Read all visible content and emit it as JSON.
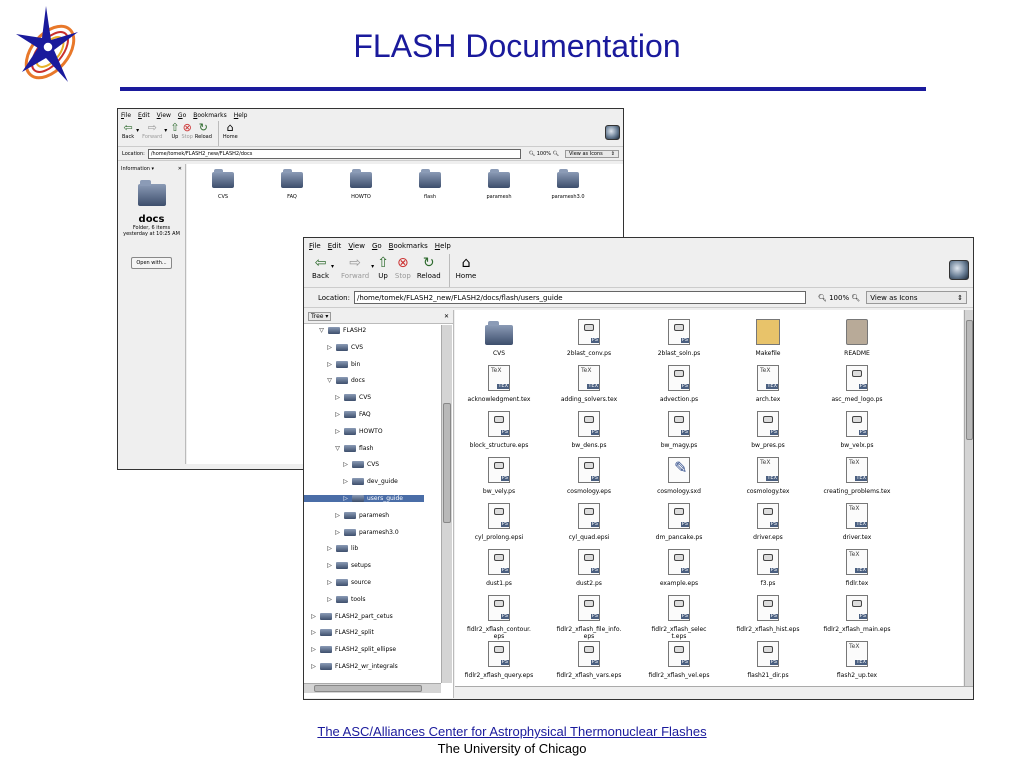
{
  "slide": {
    "title": "FLASH Documentation",
    "footer_line1": "The ASC/Alliances Center for Astrophysical Thermonuclear Flashes",
    "footer_line2": "The University of Chicago"
  },
  "colors": {
    "slide_blue": "#1a1a9c",
    "folder_blue": "#3d4e6c"
  },
  "menu": [
    "File",
    "Edit",
    "View",
    "Go",
    "Bookmarks",
    "Help"
  ],
  "toolbar": {
    "back": "Back",
    "forward": "Forward",
    "up": "Up",
    "stop": "Stop",
    "reload": "Reload",
    "home": "Home"
  },
  "back_window": {
    "location_label": "Location:",
    "location": "/home/tomek/FLASH2_new/FLASH2/docs",
    "zoom": "100%",
    "view_as": "View as Icons",
    "panel_title": "Information",
    "folder_name": "docs",
    "folder_info": "Folder, 6 items",
    "folder_date": "yesterday at 10:25 AM",
    "open_with": "Open with...",
    "items": [
      "CVS",
      "FAQ",
      "HOWTO",
      "flash",
      "paramesh",
      "paramesh3.0"
    ]
  },
  "front_window": {
    "location_label": "Location:",
    "location": "/home/tomek/FLASH2_new/FLASH2/docs/flash/users_guide",
    "zoom": "100%",
    "view_as": "View as Icons",
    "tree_label": "Tree",
    "tree": [
      {
        "label": "FLASH2",
        "indent": 1,
        "open": true
      },
      {
        "label": "CVS",
        "indent": 2
      },
      {
        "label": "bin",
        "indent": 2
      },
      {
        "label": "docs",
        "indent": 2,
        "open": true
      },
      {
        "label": "CVS",
        "indent": 3
      },
      {
        "label": "FAQ",
        "indent": 3
      },
      {
        "label": "HOWTO",
        "indent": 3
      },
      {
        "label": "flash",
        "indent": 3,
        "open": true
      },
      {
        "label": "CVS",
        "indent": 4
      },
      {
        "label": "dev_guide",
        "indent": 4
      },
      {
        "label": "users_guide",
        "indent": 4,
        "selected": true
      },
      {
        "label": "paramesh",
        "indent": 3
      },
      {
        "label": "paramesh3.0",
        "indent": 3
      },
      {
        "label": "lib",
        "indent": 2
      },
      {
        "label": "setups",
        "indent": 2
      },
      {
        "label": "source",
        "indent": 2
      },
      {
        "label": "tools",
        "indent": 2
      },
      {
        "label": "FLASH2_part_cetus",
        "indent": 0
      },
      {
        "label": "FLASH2_split",
        "indent": 0
      },
      {
        "label": "FLASH2_split_ellipse",
        "indent": 0
      },
      {
        "label": "FLASH2_wr_integrals",
        "indent": 0
      }
    ],
    "files": [
      {
        "name": "CVS",
        "kind": "folder"
      },
      {
        "name": "2blast_conv.ps",
        "kind": "ps"
      },
      {
        "name": "2blast_soln.ps",
        "kind": "ps"
      },
      {
        "name": "Makefile",
        "kind": "make"
      },
      {
        "name": "README",
        "kind": "plain"
      },
      {
        "name": "acknowledgment.tex",
        "kind": "tex"
      },
      {
        "name": "adding_solvers.tex",
        "kind": "tex"
      },
      {
        "name": "advection.ps",
        "kind": "ps"
      },
      {
        "name": "arch.tex",
        "kind": "tex"
      },
      {
        "name": "asc_med_logo.ps",
        "kind": "ps"
      },
      {
        "name": "block_structure.eps",
        "kind": "ps"
      },
      {
        "name": "bw_dens.ps",
        "kind": "ps"
      },
      {
        "name": "bw_magy.ps",
        "kind": "ps"
      },
      {
        "name": "bw_pres.ps",
        "kind": "ps"
      },
      {
        "name": "bw_velx.ps",
        "kind": "ps"
      },
      {
        "name": "bw_vely.ps",
        "kind": "ps"
      },
      {
        "name": "cosmology.eps",
        "kind": "ps"
      },
      {
        "name": "cosmology.sxd",
        "kind": "sxd"
      },
      {
        "name": "cosmology.tex",
        "kind": "tex"
      },
      {
        "name": "creating_problems.tex",
        "kind": "tex"
      },
      {
        "name": "cyl_prolong.epsi",
        "kind": "ps"
      },
      {
        "name": "cyl_quad.epsi",
        "kind": "ps"
      },
      {
        "name": "dm_pancake.ps",
        "kind": "ps"
      },
      {
        "name": "driver.eps",
        "kind": "ps"
      },
      {
        "name": "driver.tex",
        "kind": "tex"
      },
      {
        "name": "dust1.ps",
        "kind": "ps"
      },
      {
        "name": "dust2.ps",
        "kind": "ps"
      },
      {
        "name": "example.eps",
        "kind": "ps"
      },
      {
        "name": "f3.ps",
        "kind": "ps"
      },
      {
        "name": "fidlr.tex",
        "kind": "tex"
      },
      {
        "name": "fidlr2_xflash_contour.eps",
        "kind": "ps",
        "l1": "fidlr2_xflash_contour.",
        "l2": "eps"
      },
      {
        "name": "fidlr2_xflash_file_info.eps",
        "kind": "ps",
        "l1": "fidlr2_xflash_file_info.",
        "l2": "eps"
      },
      {
        "name": "fidlr2_xflash_select.eps",
        "kind": "ps",
        "l1": "fidlr2_xflash_selec",
        "l2": "t.eps"
      },
      {
        "name": "fidlr2_xflash_hist.eps",
        "kind": "ps"
      },
      {
        "name": "fidlr2_xflash_main.eps",
        "kind": "ps"
      },
      {
        "name": "fidlr2_xflash_query.eps",
        "kind": "ps"
      },
      {
        "name": "fidlr2_xflash_vars.eps",
        "kind": "ps"
      },
      {
        "name": "fidlr2_xflash_vel.eps",
        "kind": "ps"
      },
      {
        "name": "flash21_dir.ps",
        "kind": "ps"
      },
      {
        "name": "flash2_up.tex",
        "kind": "tex"
      }
    ]
  }
}
